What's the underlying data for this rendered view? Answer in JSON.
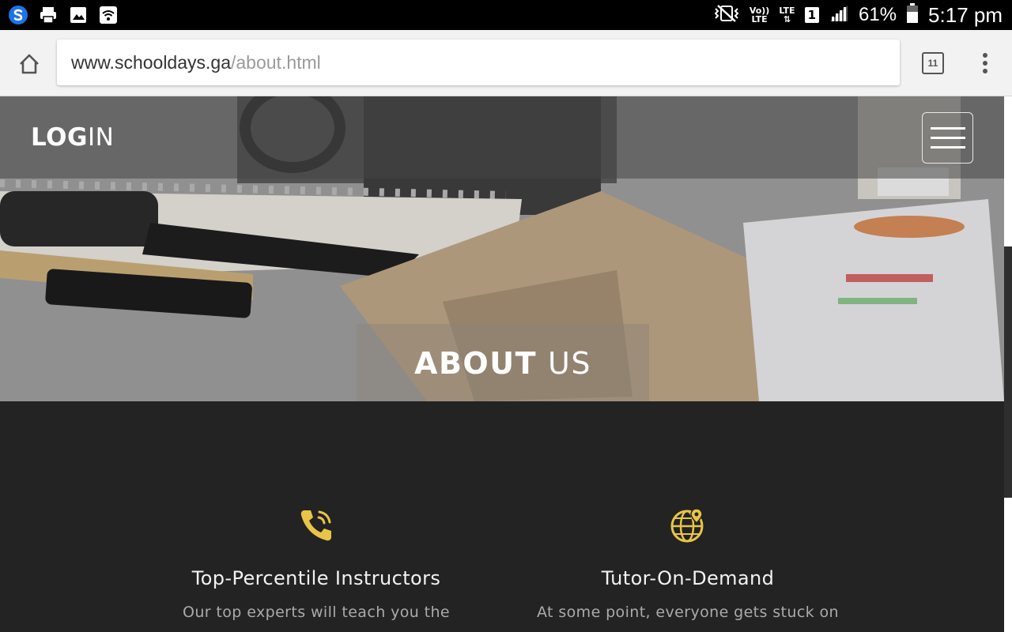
{
  "status_bar": {
    "battery_percent": "61%",
    "time": "5:17 pm",
    "network_tech_top": "Vo))",
    "network_tech_bottom": "LTE",
    "lte_label": "LTE",
    "sim_slot": "1",
    "left_icons": [
      "s-app-icon",
      "printer-icon",
      "image-icon",
      "wifi-icon"
    ],
    "right_icons": [
      "vibrate-mute-icon",
      "volte-icon",
      "lte-data-icon",
      "signal-icon",
      "battery-icon"
    ]
  },
  "browser": {
    "url_host": "www.schooldays.ga",
    "url_path": "/about.html",
    "tab_count": "11"
  },
  "site": {
    "login_bold": "LOG",
    "login_regular": "IN",
    "hero_title_bold": "ABOUT",
    "hero_title_regular": "US",
    "accent_color": "#e8c547"
  },
  "features": [
    {
      "icon": "phone-call-icon",
      "title": "Top-Percentile Instructors",
      "text": "Our top experts will teach you the"
    },
    {
      "icon": "globe-location-icon",
      "title": "Tutor-On-Demand",
      "text": "At some point, everyone gets stuck on"
    }
  ]
}
